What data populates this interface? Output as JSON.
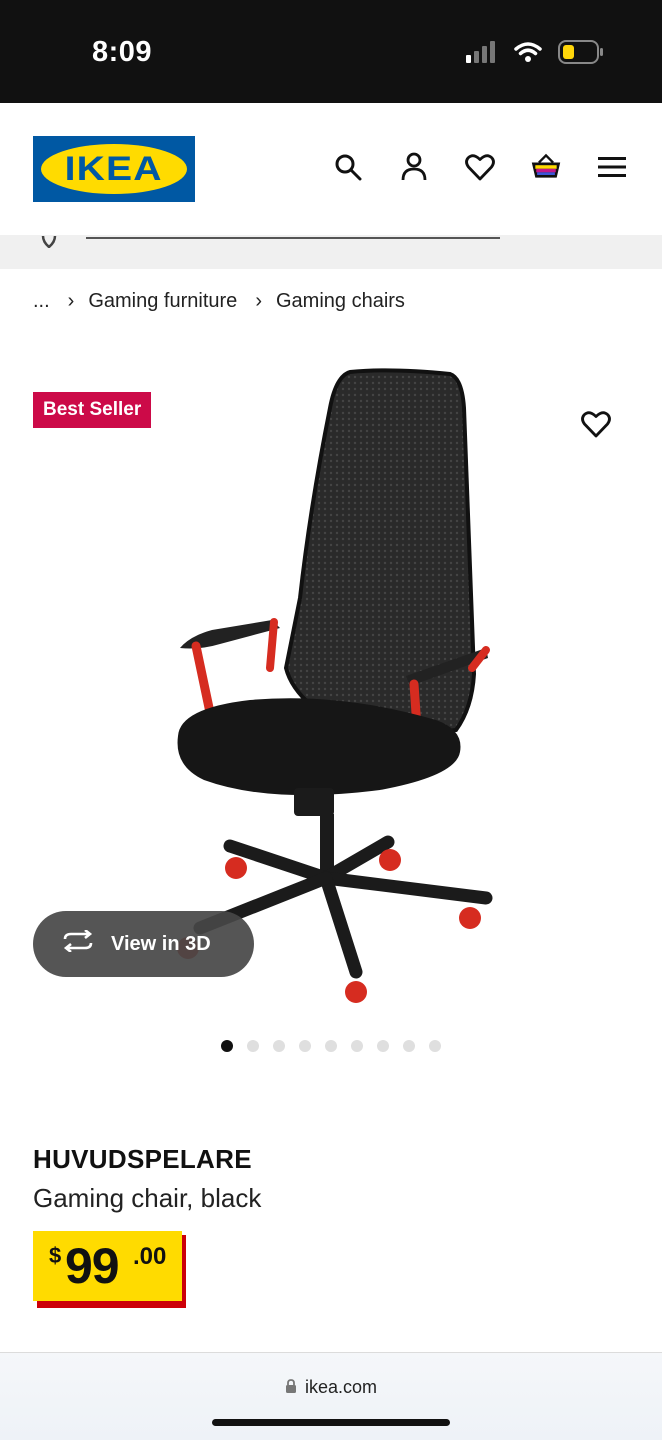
{
  "status_bar": {
    "time": "8:09"
  },
  "header": {
    "logo_text": "IKEA",
    "icons": [
      "search-icon",
      "account-icon",
      "wishlist-icon",
      "cart-icon",
      "menu-icon"
    ]
  },
  "breadcrumb": {
    "ellipsis": "...",
    "items": [
      "Gaming furniture",
      "Gaming chairs"
    ]
  },
  "gallery": {
    "badge": "Best Seller",
    "view_3d_label": "View in 3D",
    "dots_total": 9,
    "active_dot": 1
  },
  "product": {
    "name": "HUVUDSPELARE",
    "description": "Gaming chair, black",
    "price": {
      "currency": "$",
      "integer": "99",
      "decimal": ".00"
    }
  },
  "browser": {
    "url": "ikea.com"
  },
  "colors": {
    "ikea_blue": "#0058a3",
    "ikea_yellow": "#ffdb00",
    "badge_red": "#cc0a48",
    "price_shadow_red": "#cc0008"
  }
}
